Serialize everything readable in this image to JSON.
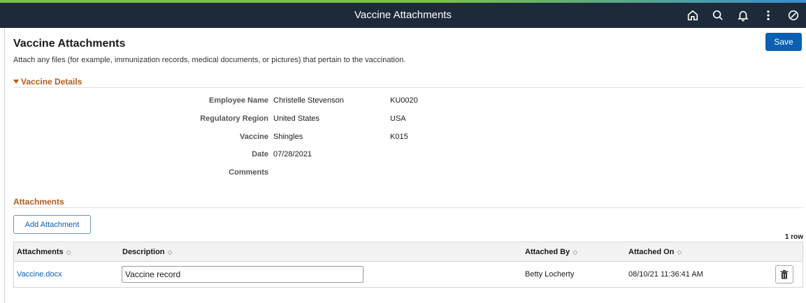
{
  "banner": {
    "title": "Vaccine Attachments",
    "icons": [
      "home-icon",
      "search-icon",
      "notification-bell-icon",
      "more-actions-icon",
      "navbar-icon"
    ]
  },
  "page": {
    "title": "Vaccine Attachments",
    "description": "Attach any files (for example, immunization records, medical documents, or pictures) that pertain to the vaccination.",
    "save_label": "Save"
  },
  "vaccine_details": {
    "header": "Vaccine Details",
    "fields": [
      {
        "label": "Employee Name",
        "value": "Christelle Stevenson",
        "code": "KU0020"
      },
      {
        "label": "Regulatory Region",
        "value": "United States",
        "code": "USA"
      },
      {
        "label": "Vaccine",
        "value": "Shingles",
        "code": "K015"
      },
      {
        "label": "Date",
        "value": "07/28/2021",
        "code": ""
      },
      {
        "label": "Comments",
        "value": "",
        "code": ""
      }
    ]
  },
  "attachments": {
    "header": "Attachments",
    "add_label": "Add Attachment",
    "row_count": "1 row",
    "columns": [
      "Attachments",
      "Description",
      "Attached By",
      "Attached On"
    ],
    "rows": [
      {
        "file": "Vaccine.docx",
        "description": "Vaccine record",
        "attached_by": "Betty Locherty",
        "attached_on": "08/10/21 11:36:41 AM"
      }
    ]
  },
  "colors": {
    "banner_bg": "#1d2a3a",
    "section_header": "#b25b1e",
    "primary_button": "#0a5fb4",
    "link": "#0a5fb4"
  }
}
